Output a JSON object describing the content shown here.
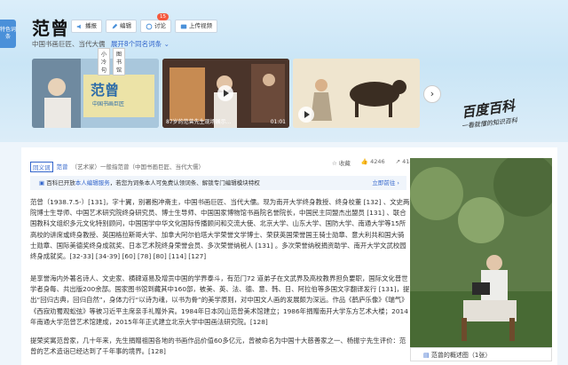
{
  "side_badge": "特色词条",
  "title": "范曾",
  "actions": {
    "collect": "播报",
    "edit": "编辑",
    "discuss": "讨论",
    "discuss_count": "15",
    "upload": "上传视频"
  },
  "subtitle": "中国书画巨匠、当代大儒",
  "subtitle_more": "展开8个同名词条",
  "media": {
    "m1_title": "范曾",
    "m1_sub": "中国书画巨匠",
    "m1_tag1": "小冷句",
    "m1_tag2": "图书馆",
    "m2_caption": "87岁的范曾先生现场展示...",
    "m2_time": "01:01"
  },
  "logo": "百度百科",
  "slogan": "一看就懂的知识百科",
  "tags": {
    "box": "同义词",
    "word": "范曾",
    "rest": "（艺术家）一般指范曾（中国书画巨匠、当代大儒）"
  },
  "stats": {
    "star": "收藏",
    "likes": "4246",
    "shares": "414"
  },
  "notice": {
    "a": "百科已开放",
    "b": "本人编辑服务",
    "c": "，若您为词条本人可免费认领词条、解锁专门编辑模块特权",
    "go": "立即前往 ›"
  },
  "p1": "范曾（1938.7.5-）[131]，字十翼，别署抱冲斋主，中国书画巨匠、当代大儒。现为南开大学终身教授、终身校董 [132] 、文史两院博士生导师、中国艺术研究院终身研究员、博士生导师、中国国家博物馆书画院名誉院长，中国民主同盟杰出盟员 [131] 、联合国教科文组织多元文化特别顾问，中国国学中华文化国际传播顾问和交流大使、北京大学、山东大学、国防大学、南通大学等15所高校的讲席或终身教授、英国格拉斯哥大学、加拿大阿尔伯塔大学荣誉文学博士、荣获英国荣誉国王骑士勋章、意大利共和国大骑士勋章、国际美德奖终身成就奖、日本艺术院终身荣誉会员、多次荣誉纳税人 [131] 。多次荣誉纳税捐资助学、南开大学文武校园终身成就奖。[32-33] [34-39] [60] [78] [80] [114] [127]",
  "p2": "是享誉海内外著名诗人、文史家、横碑道易及增贡中国的学界泰斗，有范门72 道弟子在文武界及高校教界担负要职，国际文化普世学者身每、共出版200余部。国家图书馆到藏其中160部，被美、英、法、德、意、韩、日、阿拉伯等多国文字翻译发行 [131]，提出“回归古典，回归自然”，身体力行“以诗为魂，以书为骨”的美学原则，对中国文人画的发展颇为深远。作品《鹤庐乐像》《瑞气》《西寂劝蜀观蚣弦》等被习近平主席亲手礼赠外宾。1984年日本冈山范曾美术馆建立；1986年捐赠南开大学东方艺术大楼；2014年南通大学范曾艺术馆建成，2015年年正式建立北京大学中国画法研究院。[128]",
  "p3": "提荣奖寓范曾家，几十年来，先生捐赠祖国各地的书画作品价值60多亿元，曾被命名为中国十大慈善家之一、杨振宁先生评价：范曾的艺术造诣已经达到了千年事的境界。[128]",
  "photo_caption": "范曾的概述图（1张）"
}
